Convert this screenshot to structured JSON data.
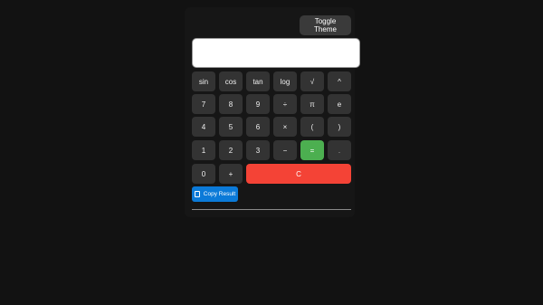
{
  "header": {
    "theme_button_label": "Toggle Theme"
  },
  "display": {
    "value": "",
    "placeholder": ""
  },
  "keys": {
    "sin": "sin",
    "cos": "cos",
    "tan": "tan",
    "log": "log",
    "sqrt": "√",
    "pow": "^",
    "d7": "7",
    "d8": "8",
    "d9": "9",
    "divide": "÷",
    "pi": "π",
    "e": "e",
    "d4": "4",
    "d5": "5",
    "d6": "6",
    "multiply": "×",
    "lparen": "(",
    "rparen": ")",
    "d1": "1",
    "d2": "2",
    "d3": "3",
    "minus": "−",
    "equals": "=",
    "dot": ".",
    "d0": "0",
    "plus": "+",
    "clear": "C"
  },
  "actions": {
    "copy_label": "Copy Result",
    "copy_icon": "clipboard-icon"
  },
  "colors": {
    "background": "#121212",
    "key": "#333333",
    "equals": "#4caf50",
    "clear": "#f44336",
    "copy": "#0b7ad8"
  }
}
